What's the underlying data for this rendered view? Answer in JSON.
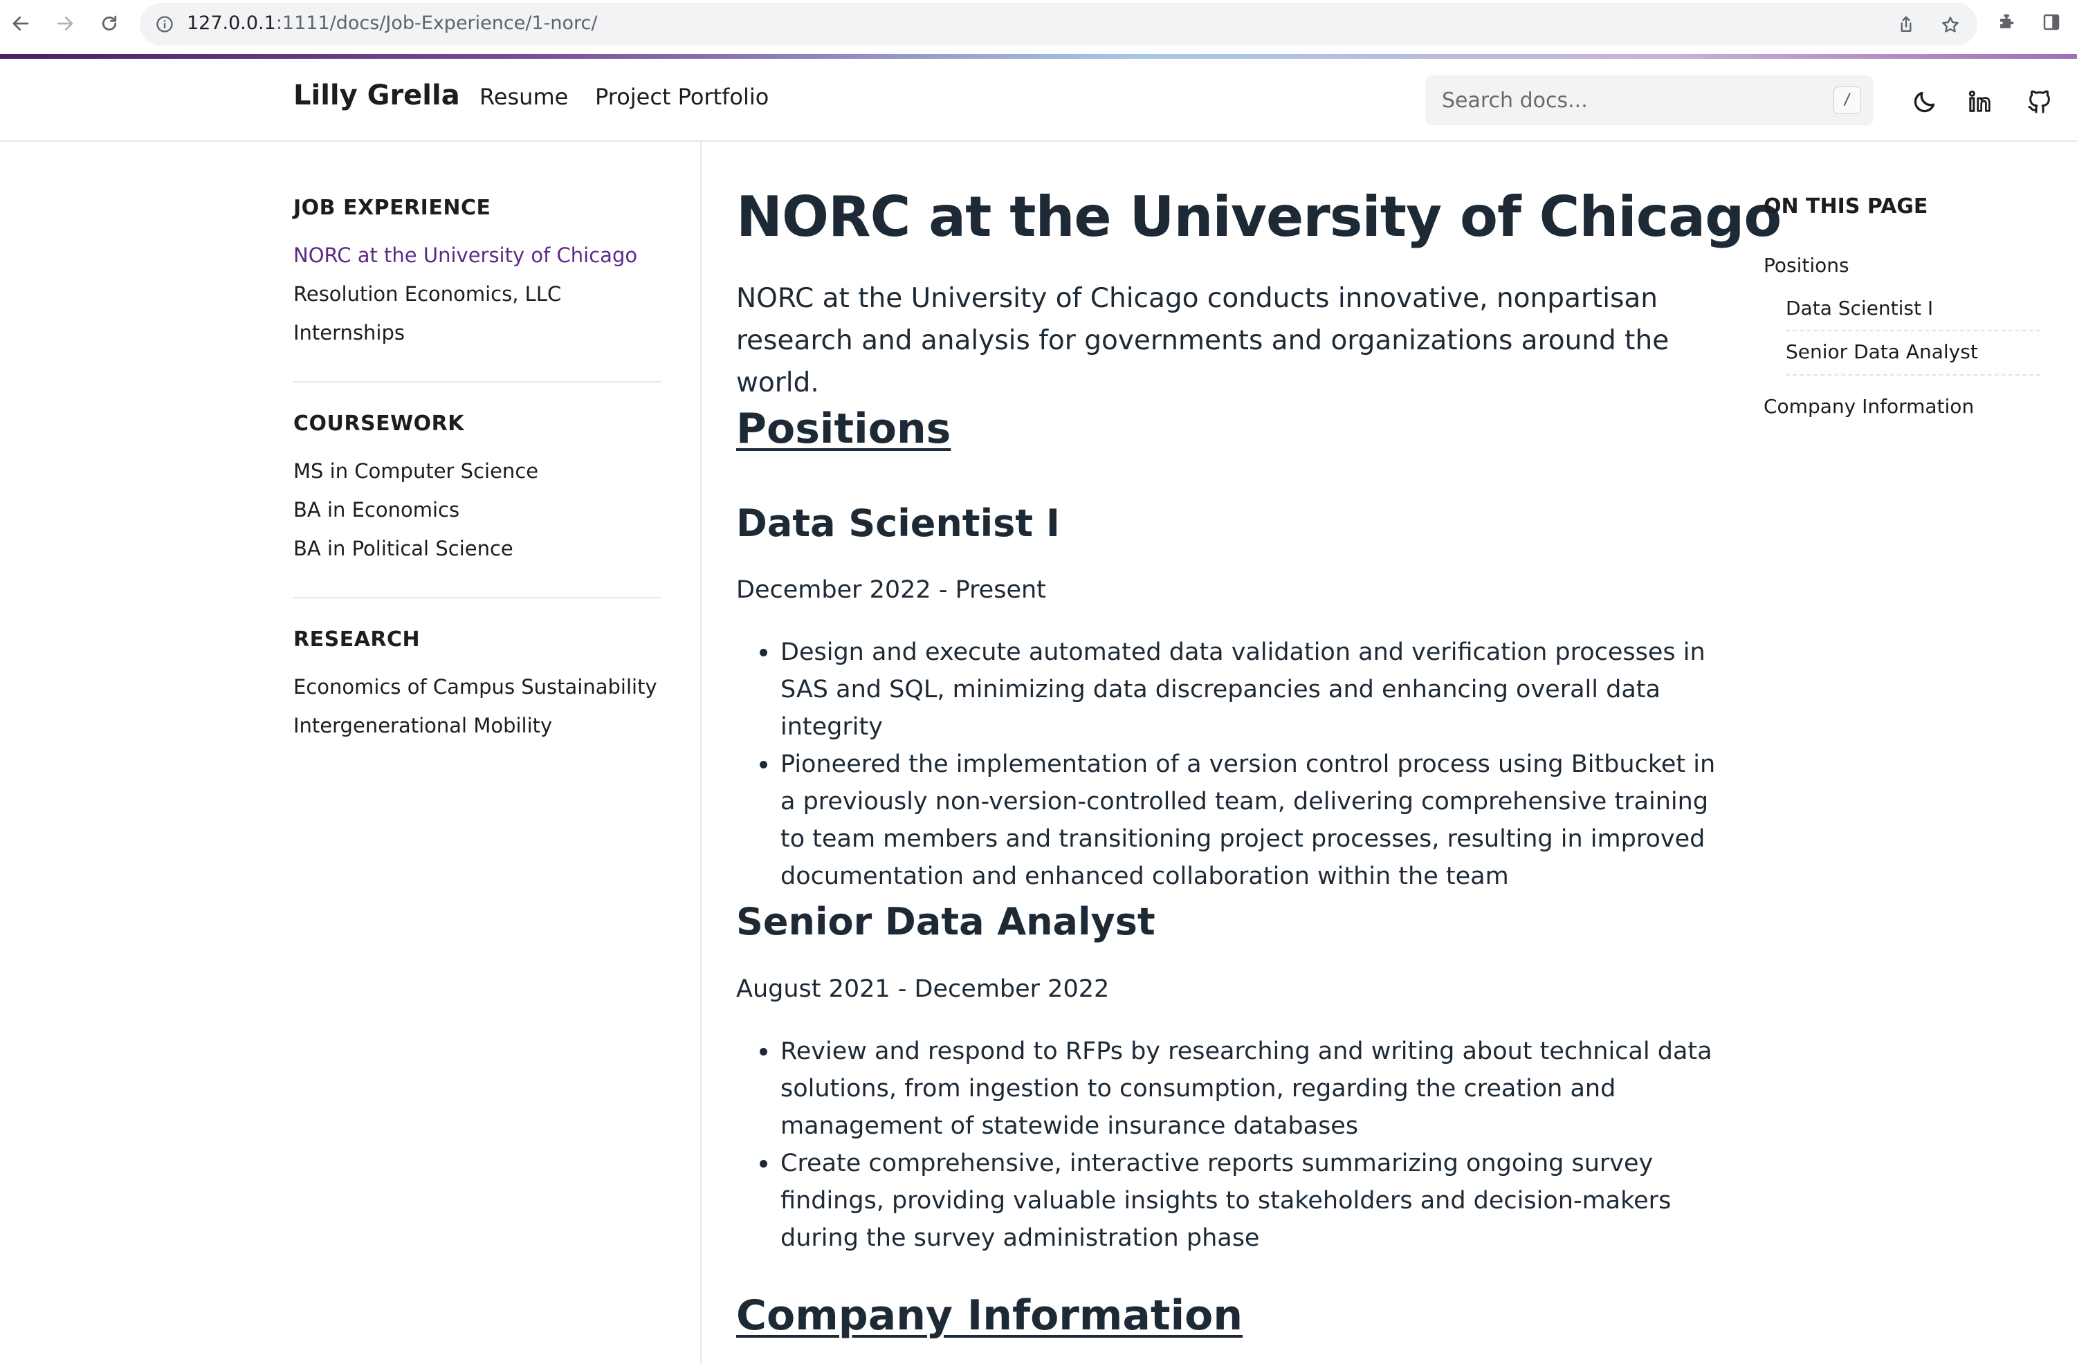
{
  "browser": {
    "url_host": "127.0.0.1",
    "url_path": ":1111/docs/Job-Experience/1-norc/"
  },
  "header": {
    "brand": "Lilly Grella",
    "nav": [
      "Resume",
      "Project Portfolio"
    ],
    "search_placeholder": "Search docs...",
    "search_shortcut": "/"
  },
  "sidebar": {
    "sections": [
      {
        "title": "JOB EXPERIENCE",
        "items": [
          "NORC at the University of Chicago",
          "Resolution Economics, LLC",
          "Internships"
        ]
      },
      {
        "title": "COURSEWORK",
        "items": [
          "MS in Computer Science",
          "BA in Economics",
          "BA in Political Science"
        ]
      },
      {
        "title": "RESEARCH",
        "items": [
          "Economics of Campus Sustainability",
          "Intergenerational Mobility"
        ]
      }
    ],
    "active_item": "NORC at the University of Chicago"
  },
  "main": {
    "title": "NORC at the University of Chicago",
    "lead": "NORC at the University of Chicago conducts innovative, nonpartisan research and analysis for governments and organizations around the world.",
    "positions_heading": "Positions",
    "positions": [
      {
        "title": "Data Scientist I",
        "dates": "December 2022 - Present",
        "bullets": [
          "Design and execute automated data validation and verification processes in SAS and SQL, minimizing data discrepancies and enhancing overall data integrity",
          "Pioneered the implementation of a version control process using Bitbucket in a previously non-version-controlled team, delivering comprehensive training to team members and transitioning project processes, resulting in improved documentation and enhanced collaboration within the team"
        ]
      },
      {
        "title": "Senior Data Analyst",
        "dates": "August 2021 - December 2022",
        "bullets": [
          "Review and respond to RFPs by researching and writing about technical data solutions, from ingestion to consumption, regarding the creation and management of statewide insurance databases",
          "Create comprehensive, interactive reports summarizing ongoing survey findings, providing valuable insights to stakeholders and decision-makers during the survey administration phase"
        ]
      }
    ],
    "company_heading": "Company Information"
  },
  "toc": {
    "title": "ON THIS PAGE",
    "items": [
      "Positions",
      "Data Scientist I",
      "Senior Data Analyst",
      "Company Information"
    ]
  },
  "colors": {
    "text": "#1d2a36",
    "active_link": "#5b2a86",
    "border": "#e7e7e9"
  },
  "icons": [
    "back-arrow-icon",
    "forward-arrow-icon",
    "reload-icon",
    "site-info-icon",
    "share-icon",
    "bookmark-star-icon",
    "extensions-puzzle-icon",
    "side-panel-icon",
    "moon-icon",
    "linkedin-icon",
    "github-icon"
  ]
}
